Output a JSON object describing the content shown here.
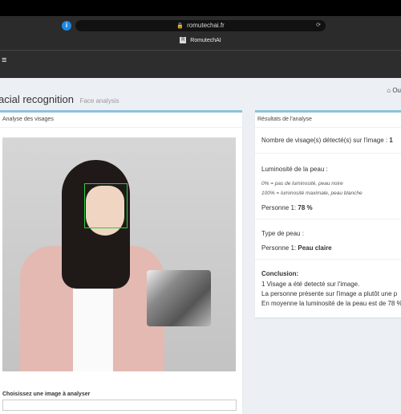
{
  "browser": {
    "url": "romutechai.fr",
    "site_title": "RomutechAI"
  },
  "page": {
    "title": "acial recognition",
    "subtitle": "Face analysis",
    "breadcrumb": "Ou"
  },
  "left_panel": {
    "header": "Analyse des visages",
    "choose_label": "Choisissez une image à analyser"
  },
  "right_panel": {
    "header": "Résultats de l'analyse",
    "faces_detected_label": "Nombre de visage(s) détecté(s) sur l'image :",
    "faces_detected_value": "1",
    "luminosity_title": "Luminosité de la peau :",
    "luminosity_note_1": "0% = pas de luminosité, peau noire",
    "luminosity_note_2": "100% = luminosité maximale, peau blanche",
    "person_luminosity_label": "Personne 1:",
    "person_luminosity_value": "78 %",
    "skin_type_title": "Type de peau :",
    "person_skin_label": "Personne 1:",
    "person_skin_value": "Peau claire",
    "conclusion_title": "Conclusion:",
    "conclusion_line_1": "1 Visage a été detecté sur l'image.",
    "conclusion_line_2": "La personne présente sur l'image a plutôt une p",
    "conclusion_line_3": "En moyenne la luminosité de la peau est de 78 %"
  },
  "icons": {
    "menu": "hamburger-menu-icon",
    "lock": "lock-icon",
    "home": "home-icon"
  },
  "colors": {
    "box_border": "#8ec1dd",
    "face_box": "#2ecc40"
  }
}
